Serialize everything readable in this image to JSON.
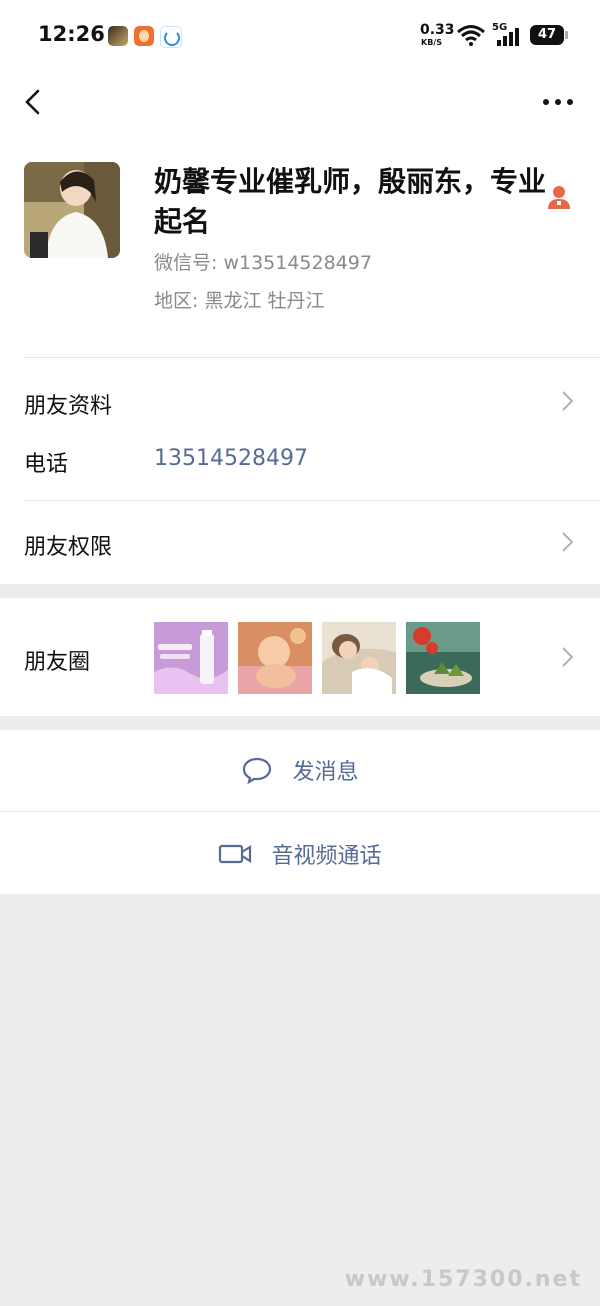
{
  "status_bar": {
    "time": "12:26",
    "net_speed": "0.33",
    "net_unit": "KB/S",
    "network": "5G",
    "battery": "47",
    "icons": [
      "app-icon-game",
      "app-icon-orange",
      "app-icon-blue",
      "wifi-icon",
      "signal-icon",
      "battery-icon"
    ]
  },
  "nav": {
    "back_icon": "chevron-left-icon",
    "more_icon": "more-dots-icon"
  },
  "profile": {
    "name": "奶馨专业催乳师，殷丽东，专业起名",
    "wechat_id": "微信号:  w13514528497",
    "region": "地区:  黑龙江  牡丹江",
    "contact_icon": "contact-person-icon"
  },
  "rows": {
    "friend_info": "朋友资料",
    "phone_label": "电话",
    "phone_value": "13514528497",
    "permissions": "朋友权限",
    "moments": "朋友圈"
  },
  "moments_thumbs": [
    "moment-product",
    "moment-baby",
    "moment-mother",
    "moment-dumplings"
  ],
  "actions": {
    "message": "发消息",
    "video_call": "音视频通话"
  },
  "watermark": "www.157300.net",
  "colors": {
    "link": "#576b95",
    "bg": "#ededed",
    "accent": "#e8674a"
  }
}
